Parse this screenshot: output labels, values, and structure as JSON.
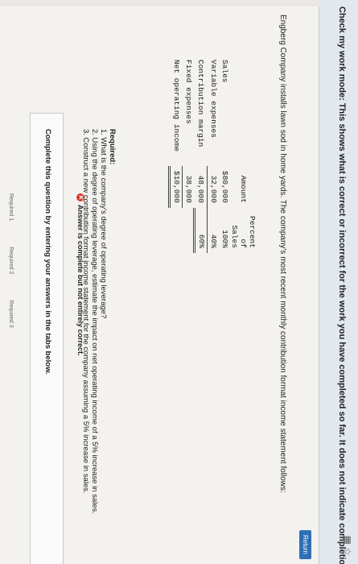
{
  "banner": {
    "mode_label": "Check my work mode",
    "message": ": This shows what is correct or incorrect for the work you have completed so far. It does not indicate completion."
  },
  "return_label": "Return",
  "intro": "Engberg Company installs lawn sod in home yards. The company's most recent monthly contribution format income statement follows:",
  "table": {
    "headers": {
      "amount": "Amount",
      "percent": "Percent of Sales"
    },
    "rows": [
      {
        "label": "Sales",
        "amount": "$80,000",
        "percent": "100%"
      },
      {
        "label": "Variable expenses",
        "amount": "32,000",
        "percent": "40%"
      },
      {
        "label": "Contribution margin",
        "amount": "48,000",
        "percent": "60%"
      },
      {
        "label": "Fixed expenses",
        "amount": "38,000",
        "percent": ""
      },
      {
        "label": "Net operating income",
        "amount": "$10,000",
        "percent": ""
      }
    ]
  },
  "required": {
    "title": "Required:",
    "items": [
      "1. What is the company's degree of operating leverage?",
      "2. Using the degree of operating leverage, estimate the impact on net operating income of a 5% increase in sales.",
      "3. Construct a new contribution format income statement for the company assuming a 5% increase in sales."
    ]
  },
  "status": "Answer is complete but not entirely correct.",
  "complete_prompt": "Complete this question by entering your answers in the tabs below.",
  "tabs": [
    "Required 1",
    "Required 2",
    "Required 3"
  ]
}
